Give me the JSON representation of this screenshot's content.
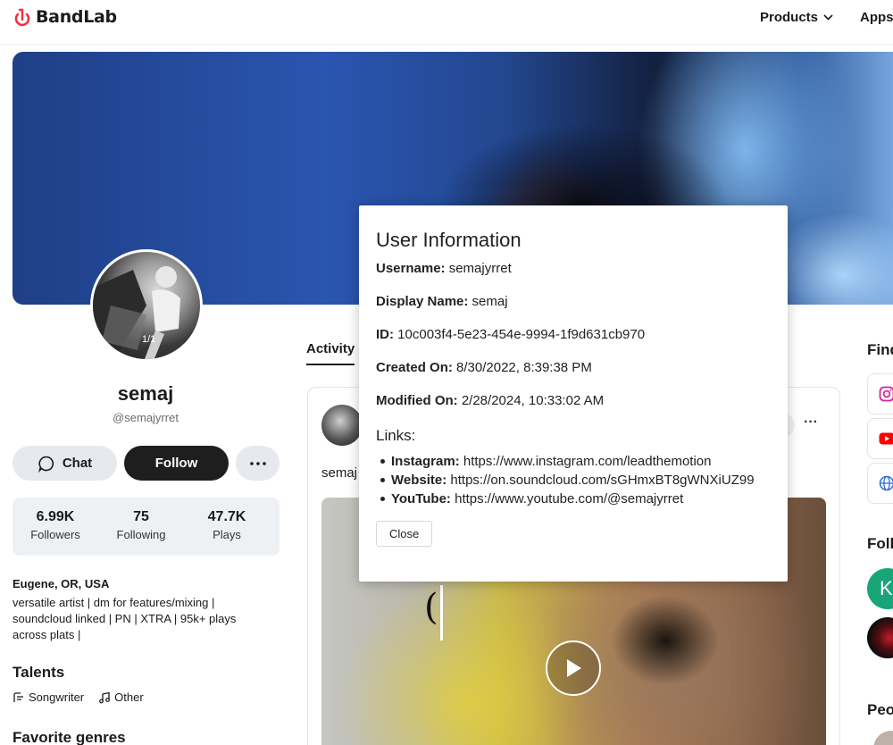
{
  "header": {
    "logo_text": "BandLab",
    "products_label": "Products",
    "apps_label": "Apps"
  },
  "profile": {
    "avatar_counter": "1/1",
    "name": "semaj",
    "handle": "@semajyrret",
    "chat_label": "Chat",
    "follow_label": "Follow",
    "more_label": "···",
    "stats": [
      {
        "value": "6.99K",
        "label": "Followers"
      },
      {
        "value": "75",
        "label": "Following"
      },
      {
        "value": "47.7K",
        "label": "Plays"
      }
    ],
    "location": "Eugene, OR, USA",
    "bio": "versatile artist | dm for features/mixing | soundcloud linked | PN | XTRA | 95k+ plays across plats |",
    "talents_title": "Talents",
    "talents": [
      "Songwriter",
      "Other"
    ],
    "genres_title": "Favorite genres"
  },
  "feed": {
    "tab_label": "Activity",
    "post_author": "semaj",
    "post_more": "···",
    "media_bracket": "("
  },
  "right": {
    "find_title": "Find",
    "follow_title": "Follo",
    "circle_letter": "K",
    "people_title": "Peo"
  },
  "modal": {
    "title": "User Information",
    "username_label": "Username:",
    "username": "semajyrret",
    "display_name_label": "Display Name:",
    "display_name": "semaj",
    "id_label": "ID:",
    "id": "10c003f4-5e23-454e-9994-1f9d631cb970",
    "created_label": "Created On:",
    "created": "8/30/2022, 8:39:38 PM",
    "modified_label": "Modified On:",
    "modified": "2/28/2024, 10:33:02 AM",
    "links_title": "Links:",
    "links": [
      {
        "label": "Instagram:",
        "url": "https://www.instagram.com/leadthemotion"
      },
      {
        "label": "Website:",
        "url": "https://on.soundcloud.com/sGHmxBT8gWNXiUZ99"
      },
      {
        "label": "YouTube:",
        "url": "https://www.youtube.com/@semajyrret"
      }
    ],
    "close_label": "Close"
  },
  "colors": {
    "brand": "#f2323f",
    "follow_button": "#1e1e1e",
    "secondary_button": "#e6eaee",
    "avatar_green": "#18a578"
  },
  "icons": [
    "bandlab-logo-icon",
    "chevron-down-icon",
    "chat-bubble-icon",
    "more-dots-icon",
    "songwriter-icon",
    "music-note-icon",
    "play-icon",
    "instagram-icon",
    "youtube-icon",
    "globe-icon"
  ]
}
